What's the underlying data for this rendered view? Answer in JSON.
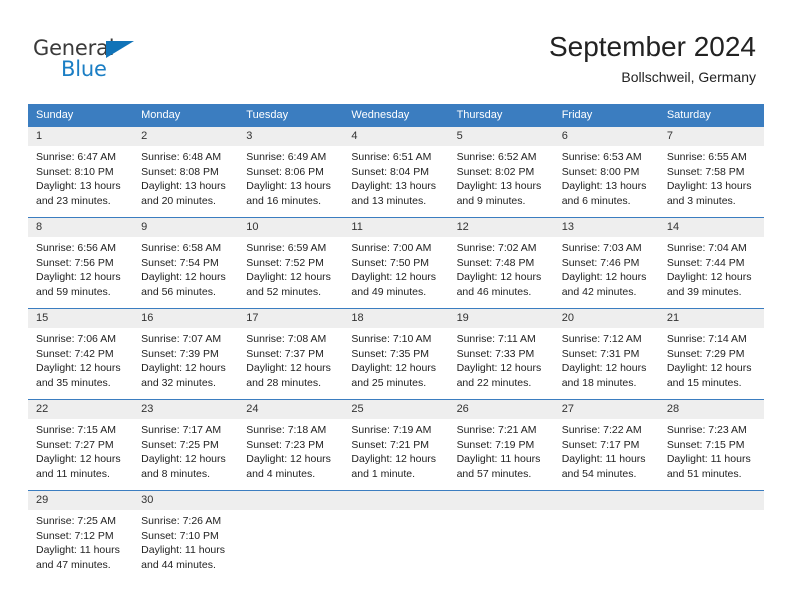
{
  "brand": {
    "name_part1": "General",
    "name_part2": "Blue",
    "triangle_color": "#1073b8",
    "blue_color": "#1b7ec4"
  },
  "header": {
    "title": "September 2024",
    "subtitle": "Bollschweil, Germany"
  },
  "theme": {
    "header_blue": "#3b7dc0",
    "daynum_band": "#eeeeee"
  },
  "weekdays": [
    "Sunday",
    "Monday",
    "Tuesday",
    "Wednesday",
    "Thursday",
    "Friday",
    "Saturday"
  ],
  "weeks": [
    [
      {
        "day": "1",
        "sunrise": "Sunrise: 6:47 AM",
        "sunset": "Sunset: 8:10 PM",
        "daylight_line1": "Daylight: 13 hours",
        "daylight_line2": "and 23 minutes."
      },
      {
        "day": "2",
        "sunrise": "Sunrise: 6:48 AM",
        "sunset": "Sunset: 8:08 PM",
        "daylight_line1": "Daylight: 13 hours",
        "daylight_line2": "and 20 minutes."
      },
      {
        "day": "3",
        "sunrise": "Sunrise: 6:49 AM",
        "sunset": "Sunset: 8:06 PM",
        "daylight_line1": "Daylight: 13 hours",
        "daylight_line2": "and 16 minutes."
      },
      {
        "day": "4",
        "sunrise": "Sunrise: 6:51 AM",
        "sunset": "Sunset: 8:04 PM",
        "daylight_line1": "Daylight: 13 hours",
        "daylight_line2": "and 13 minutes."
      },
      {
        "day": "5",
        "sunrise": "Sunrise: 6:52 AM",
        "sunset": "Sunset: 8:02 PM",
        "daylight_line1": "Daylight: 13 hours",
        "daylight_line2": "and 9 minutes."
      },
      {
        "day": "6",
        "sunrise": "Sunrise: 6:53 AM",
        "sunset": "Sunset: 8:00 PM",
        "daylight_line1": "Daylight: 13 hours",
        "daylight_line2": "and 6 minutes."
      },
      {
        "day": "7",
        "sunrise": "Sunrise: 6:55 AM",
        "sunset": "Sunset: 7:58 PM",
        "daylight_line1": "Daylight: 13 hours",
        "daylight_line2": "and 3 minutes."
      }
    ],
    [
      {
        "day": "8",
        "sunrise": "Sunrise: 6:56 AM",
        "sunset": "Sunset: 7:56 PM",
        "daylight_line1": "Daylight: 12 hours",
        "daylight_line2": "and 59 minutes."
      },
      {
        "day": "9",
        "sunrise": "Sunrise: 6:58 AM",
        "sunset": "Sunset: 7:54 PM",
        "daylight_line1": "Daylight: 12 hours",
        "daylight_line2": "and 56 minutes."
      },
      {
        "day": "10",
        "sunrise": "Sunrise: 6:59 AM",
        "sunset": "Sunset: 7:52 PM",
        "daylight_line1": "Daylight: 12 hours",
        "daylight_line2": "and 52 minutes."
      },
      {
        "day": "11",
        "sunrise": "Sunrise: 7:00 AM",
        "sunset": "Sunset: 7:50 PM",
        "daylight_line1": "Daylight: 12 hours",
        "daylight_line2": "and 49 minutes."
      },
      {
        "day": "12",
        "sunrise": "Sunrise: 7:02 AM",
        "sunset": "Sunset: 7:48 PM",
        "daylight_line1": "Daylight: 12 hours",
        "daylight_line2": "and 46 minutes."
      },
      {
        "day": "13",
        "sunrise": "Sunrise: 7:03 AM",
        "sunset": "Sunset: 7:46 PM",
        "daylight_line1": "Daylight: 12 hours",
        "daylight_line2": "and 42 minutes."
      },
      {
        "day": "14",
        "sunrise": "Sunrise: 7:04 AM",
        "sunset": "Sunset: 7:44 PM",
        "daylight_line1": "Daylight: 12 hours",
        "daylight_line2": "and 39 minutes."
      }
    ],
    [
      {
        "day": "15",
        "sunrise": "Sunrise: 7:06 AM",
        "sunset": "Sunset: 7:42 PM",
        "daylight_line1": "Daylight: 12 hours",
        "daylight_line2": "and 35 minutes."
      },
      {
        "day": "16",
        "sunrise": "Sunrise: 7:07 AM",
        "sunset": "Sunset: 7:39 PM",
        "daylight_line1": "Daylight: 12 hours",
        "daylight_line2": "and 32 minutes."
      },
      {
        "day": "17",
        "sunrise": "Sunrise: 7:08 AM",
        "sunset": "Sunset: 7:37 PM",
        "daylight_line1": "Daylight: 12 hours",
        "daylight_line2": "and 28 minutes."
      },
      {
        "day": "18",
        "sunrise": "Sunrise: 7:10 AM",
        "sunset": "Sunset: 7:35 PM",
        "daylight_line1": "Daylight: 12 hours",
        "daylight_line2": "and 25 minutes."
      },
      {
        "day": "19",
        "sunrise": "Sunrise: 7:11 AM",
        "sunset": "Sunset: 7:33 PM",
        "daylight_line1": "Daylight: 12 hours",
        "daylight_line2": "and 22 minutes."
      },
      {
        "day": "20",
        "sunrise": "Sunrise: 7:12 AM",
        "sunset": "Sunset: 7:31 PM",
        "daylight_line1": "Daylight: 12 hours",
        "daylight_line2": "and 18 minutes."
      },
      {
        "day": "21",
        "sunrise": "Sunrise: 7:14 AM",
        "sunset": "Sunset: 7:29 PM",
        "daylight_line1": "Daylight: 12 hours",
        "daylight_line2": "and 15 minutes."
      }
    ],
    [
      {
        "day": "22",
        "sunrise": "Sunrise: 7:15 AM",
        "sunset": "Sunset: 7:27 PM",
        "daylight_line1": "Daylight: 12 hours",
        "daylight_line2": "and 11 minutes."
      },
      {
        "day": "23",
        "sunrise": "Sunrise: 7:17 AM",
        "sunset": "Sunset: 7:25 PM",
        "daylight_line1": "Daylight: 12 hours",
        "daylight_line2": "and 8 minutes."
      },
      {
        "day": "24",
        "sunrise": "Sunrise: 7:18 AM",
        "sunset": "Sunset: 7:23 PM",
        "daylight_line1": "Daylight: 12 hours",
        "daylight_line2": "and 4 minutes."
      },
      {
        "day": "25",
        "sunrise": "Sunrise: 7:19 AM",
        "sunset": "Sunset: 7:21 PM",
        "daylight_line1": "Daylight: 12 hours",
        "daylight_line2": "and 1 minute."
      },
      {
        "day": "26",
        "sunrise": "Sunrise: 7:21 AM",
        "sunset": "Sunset: 7:19 PM",
        "daylight_line1": "Daylight: 11 hours",
        "daylight_line2": "and 57 minutes."
      },
      {
        "day": "27",
        "sunrise": "Sunrise: 7:22 AM",
        "sunset": "Sunset: 7:17 PM",
        "daylight_line1": "Daylight: 11 hours",
        "daylight_line2": "and 54 minutes."
      },
      {
        "day": "28",
        "sunrise": "Sunrise: 7:23 AM",
        "sunset": "Sunset: 7:15 PM",
        "daylight_line1": "Daylight: 11 hours",
        "daylight_line2": "and 51 minutes."
      }
    ],
    [
      {
        "day": "29",
        "sunrise": "Sunrise: 7:25 AM",
        "sunset": "Sunset: 7:12 PM",
        "daylight_line1": "Daylight: 11 hours",
        "daylight_line2": "and 47 minutes."
      },
      {
        "day": "30",
        "sunrise": "Sunrise: 7:26 AM",
        "sunset": "Sunset: 7:10 PM",
        "daylight_line1": "Daylight: 11 hours",
        "daylight_line2": "and 44 minutes."
      },
      {
        "day": "",
        "sunrise": "",
        "sunset": "",
        "daylight_line1": "",
        "daylight_line2": ""
      },
      {
        "day": "",
        "sunrise": "",
        "sunset": "",
        "daylight_line1": "",
        "daylight_line2": ""
      },
      {
        "day": "",
        "sunrise": "",
        "sunset": "",
        "daylight_line1": "",
        "daylight_line2": ""
      },
      {
        "day": "",
        "sunrise": "",
        "sunset": "",
        "daylight_line1": "",
        "daylight_line2": ""
      },
      {
        "day": "",
        "sunrise": "",
        "sunset": "",
        "daylight_line1": "",
        "daylight_line2": ""
      }
    ]
  ]
}
